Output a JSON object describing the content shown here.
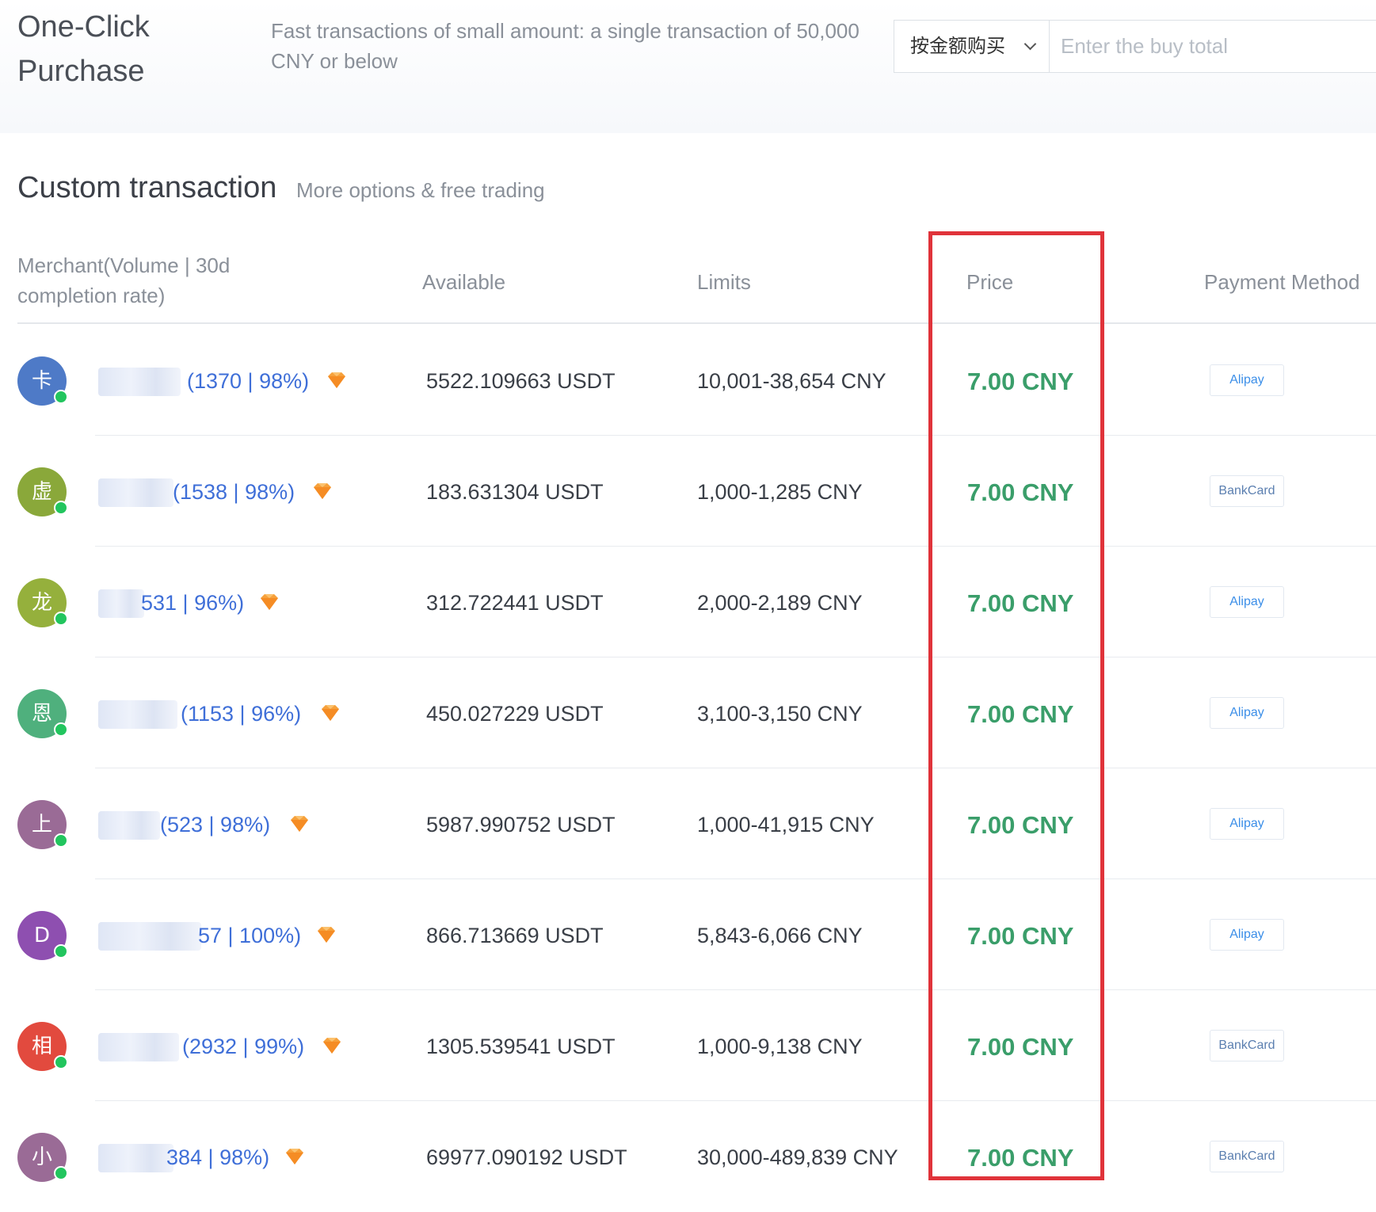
{
  "one_click": {
    "title": "One-Click Purchase",
    "description": "Fast transactions of small amount: a single transaction of 50,000 CNY or below",
    "mode_select_value": "按金额购买",
    "buy_total_placeholder": "Enter the buy total"
  },
  "custom": {
    "title": "Custom transaction",
    "subtitle": "More options & free trading"
  },
  "table": {
    "headers": {
      "merchant": "Merchant(Volume | 30d completion rate)",
      "available": "Available",
      "limits": "Limits",
      "price": "Price",
      "payment": "Payment Method"
    },
    "rows": [
      {
        "avatar_char": "卡",
        "avatar_color": "#4e7ac7",
        "stats": "(1370 | 98%)",
        "available": "5522.109663 USDT",
        "limits": "10,001-38,654 CNY",
        "price": "7.00 CNY",
        "payment": "Alipay"
      },
      {
        "avatar_char": "虚",
        "avatar_color": "#8aa83a",
        "stats": "(1538 | 98%)",
        "available": "183.631304 USDT",
        "limits": "1,000-1,285 CNY",
        "price": "7.00 CNY",
        "payment": "BankCard"
      },
      {
        "avatar_char": "龙",
        "avatar_color": "#95b03c",
        "stats": "531 | 96%)",
        "available": "312.722441 USDT",
        "limits": "2,000-2,189 CNY",
        "price": "7.00 CNY",
        "payment": "Alipay"
      },
      {
        "avatar_char": "恩",
        "avatar_color": "#4fb07d",
        "stats": "(1153 | 96%)",
        "available": "450.027229 USDT",
        "limits": "3,100-3,150 CNY",
        "price": "7.00 CNY",
        "payment": "Alipay"
      },
      {
        "avatar_char": "上",
        "avatar_color": "#9a6b96",
        "stats": "(523 | 98%)",
        "available": "5987.990752 USDT",
        "limits": "1,000-41,915 CNY",
        "price": "7.00 CNY",
        "payment": "Alipay"
      },
      {
        "avatar_char": "D",
        "avatar_color": "#8e4fb0",
        "stats": "57 | 100%)",
        "available": "866.713669 USDT",
        "limits": "5,843-6,066 CNY",
        "price": "7.00 CNY",
        "payment": "Alipay"
      },
      {
        "avatar_char": "相",
        "avatar_color": "#e24a3e",
        "stats": "(2932 | 99%)",
        "available": "1305.539541 USDT",
        "limits": "1,000-9,138 CNY",
        "price": "7.00 CNY",
        "payment": "BankCard"
      },
      {
        "avatar_char": "小",
        "avatar_color": "#9a6b96",
        "stats": "384 | 98%)",
        "available": "69977.090192 USDT",
        "limits": "30,000-489,839 CNY",
        "price": "7.00 CNY",
        "payment": "BankCard"
      }
    ]
  },
  "colors": {
    "price_green": "#3a9e6a",
    "highlight_red": "#e0333a",
    "stats_blue": "#3f6fd8",
    "online_green": "#22c55e"
  },
  "icons": {
    "merchant_badge": "diamond-icon",
    "online_status": "online-dot-icon",
    "dropdown": "chevron-down-icon"
  }
}
